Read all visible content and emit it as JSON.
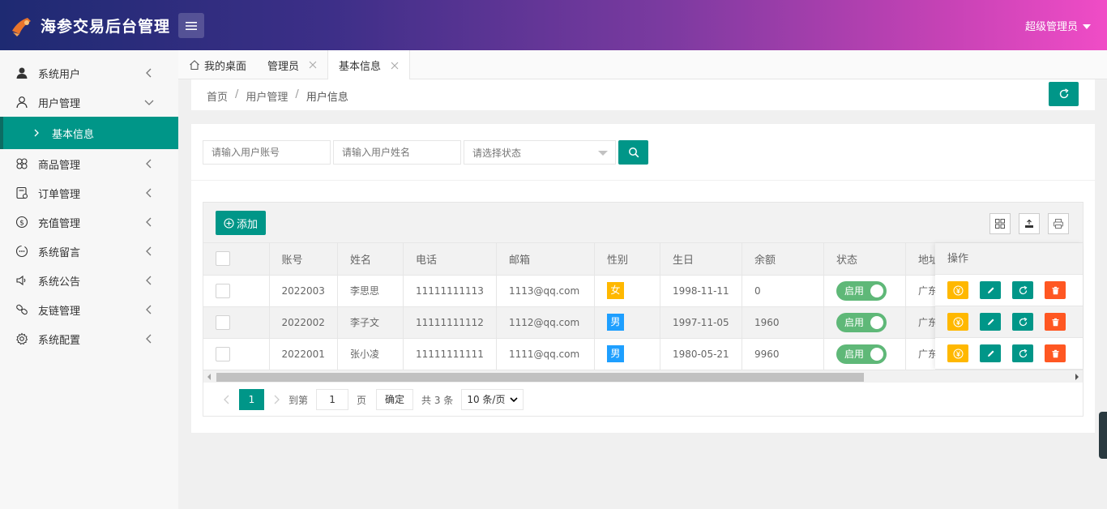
{
  "app": {
    "title": "海参交易后台管理",
    "user_label": "超级管理员"
  },
  "sidebar": {
    "items": [
      {
        "label": "系统用户",
        "icon": "user-icon"
      },
      {
        "label": "用户管理",
        "icon": "user-outline-icon"
      },
      {
        "label": "商品管理",
        "icon": "clover-icon"
      },
      {
        "label": "订单管理",
        "icon": "order-icon"
      },
      {
        "label": "充值管理",
        "icon": "dollar-icon"
      },
      {
        "label": "系统留言",
        "icon": "message-icon"
      },
      {
        "label": "系统公告",
        "icon": "speaker-icon"
      },
      {
        "label": "友链管理",
        "icon": "link-icon"
      },
      {
        "label": "系统配置",
        "icon": "gear-icon"
      }
    ],
    "active_sub": "基本信息"
  },
  "tabs": [
    {
      "label": "我的桌面"
    },
    {
      "label": "管理员"
    },
    {
      "label": "基本信息"
    }
  ],
  "breadcrumb": {
    "home": "首页",
    "level1": "用户管理",
    "current": "用户信息"
  },
  "search": {
    "account_placeholder": "请输入用户账号",
    "name_placeholder": "请输入用户姓名",
    "status_placeholder": "请选择状态"
  },
  "toolbar": {
    "add_label": "添加"
  },
  "table": {
    "headers": [
      "账号",
      "姓名",
      "电话",
      "邮箱",
      "性别",
      "生日",
      "余额",
      "状态",
      "地址",
      "操作"
    ],
    "rows": [
      {
        "account": "2022003",
        "name": "李思思",
        "phone": "11111111113",
        "email": "1113@qq.com",
        "gender": "女",
        "birthday": "1998-11-11",
        "balance": "0",
        "status": "启用",
        "address": "广东深圳"
      },
      {
        "account": "2022002",
        "name": "李子文",
        "phone": "11111111112",
        "email": "1112@qq.com",
        "gender": "男",
        "birthday": "1997-11-05",
        "balance": "1960",
        "status": "启用",
        "address": "广东深圳"
      },
      {
        "account": "2022001",
        "name": "张小凌",
        "phone": "11111111111",
        "email": "1111@qq.com",
        "gender": "男",
        "birthday": "1980-05-21",
        "balance": "9960",
        "status": "启用",
        "address": "广东深圳"
      }
    ]
  },
  "pager": {
    "current_page": "1",
    "goto_label": "到第",
    "goto_value": "1",
    "page_unit": "页",
    "confirm_label": "确定",
    "total_label": "共 3 条",
    "limit_label": "10 条/页"
  },
  "colors": {
    "accent": "#009688",
    "warn": "#FFB800",
    "danger": "#FF5722",
    "info": "#1E9FFF",
    "switch_on": "#5FB878"
  }
}
